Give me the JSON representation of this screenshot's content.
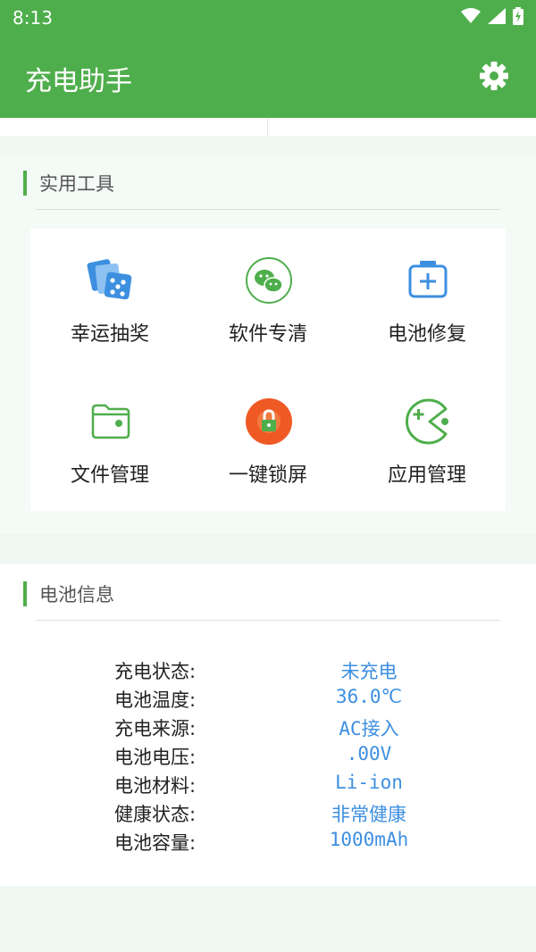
{
  "status_bar": {
    "time": "8:13"
  },
  "app_bar": {
    "title": "充电助手"
  },
  "tools": {
    "title": "实用工具",
    "items": [
      {
        "label": "幸运抽奖",
        "icon": "dice-cards-icon"
      },
      {
        "label": "软件专清",
        "icon": "wechat-icon"
      },
      {
        "label": "电池修复",
        "icon": "battery-plus-icon"
      },
      {
        "label": "文件管理",
        "icon": "folder-icon"
      },
      {
        "label": "一键锁屏",
        "icon": "lock-icon"
      },
      {
        "label": "应用管理",
        "icon": "pacman-icon"
      }
    ]
  },
  "battery_info": {
    "title": "电池信息",
    "rows": [
      {
        "key": "充电状态:",
        "value": "未充电"
      },
      {
        "key": "电池温度:",
        "value": "36.0℃"
      },
      {
        "key": "充电来源:",
        "value": "AC接入"
      },
      {
        "key": "电池电压:",
        "value": ".00V"
      },
      {
        "key": "电池材料:",
        "value": "Li-ion"
      },
      {
        "key": "健康状态:",
        "value": "非常健康"
      },
      {
        "key": "电池容量:",
        "value": "1000mAh"
      }
    ]
  },
  "colors": {
    "primary": "#4fae4c",
    "value_text": "#3d8fe0",
    "lock_bg": "#ef5a24"
  }
}
